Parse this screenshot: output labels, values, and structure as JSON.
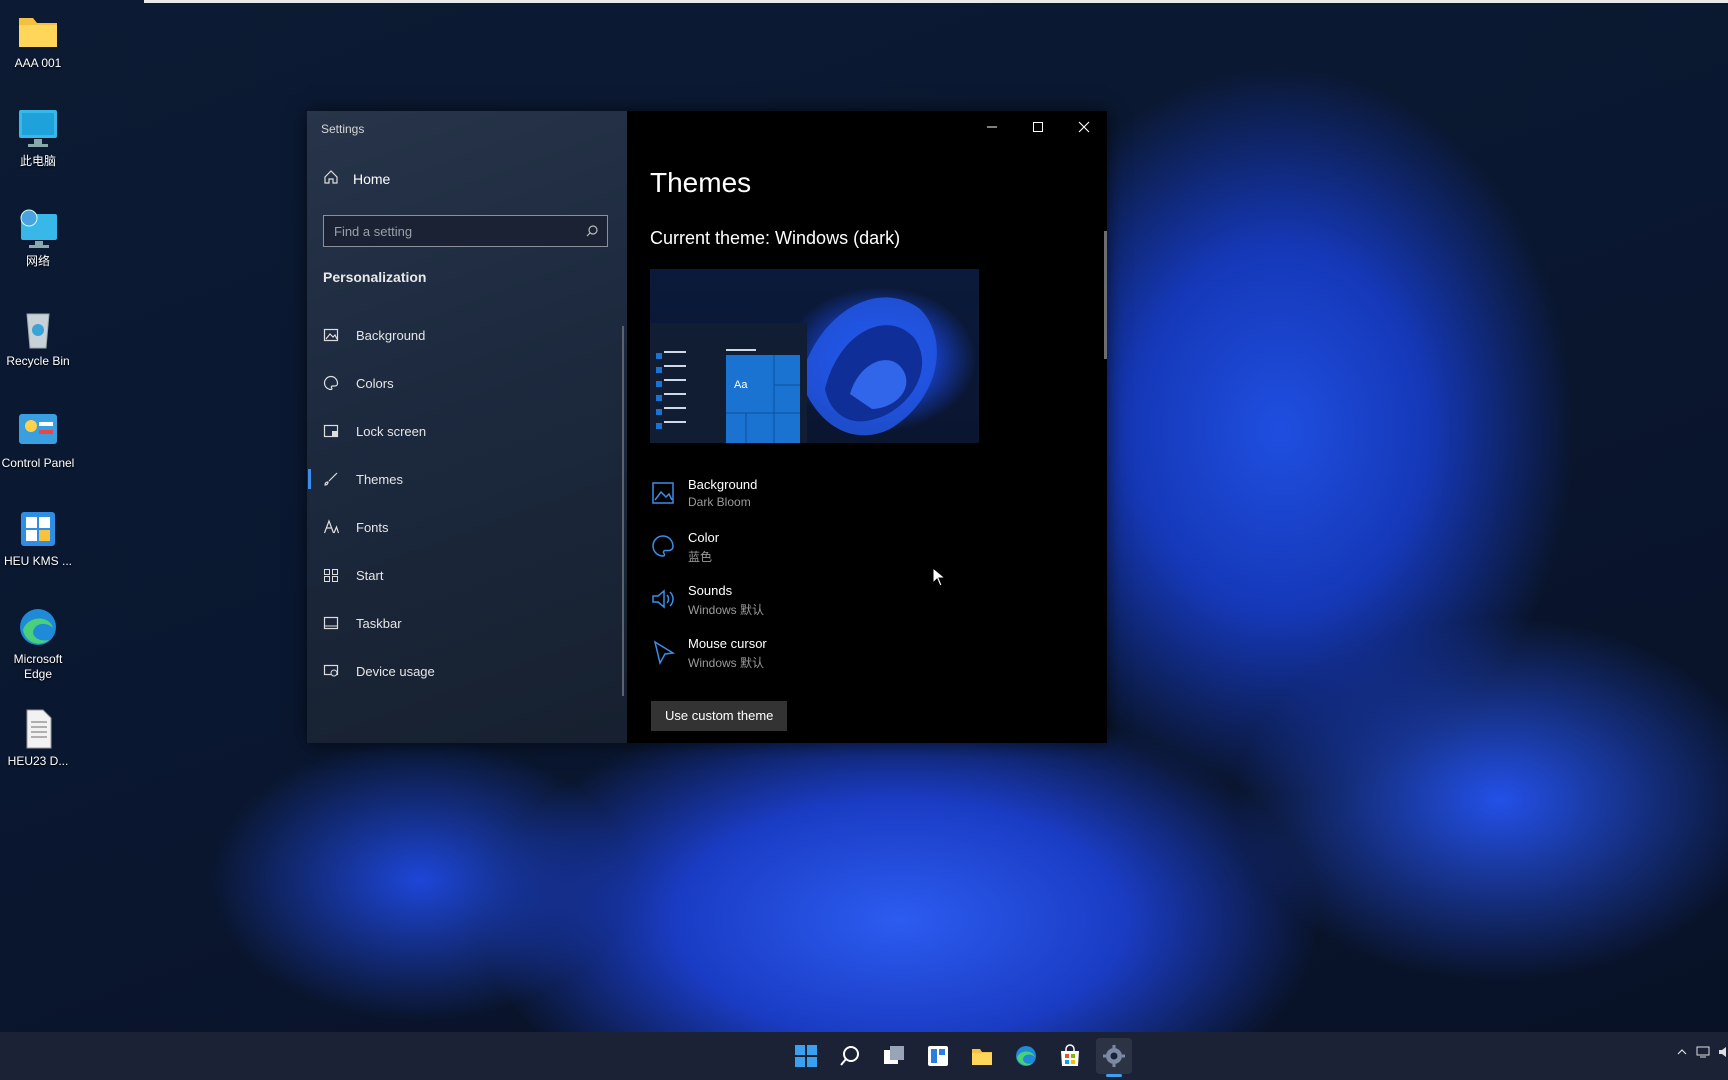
{
  "desktop": {
    "icons": [
      {
        "label": "AAA 001",
        "icon": "folder-icon"
      },
      {
        "label": "此电脑",
        "icon": "computer-icon"
      },
      {
        "label": "网络",
        "icon": "network-icon"
      },
      {
        "label": "Recycle Bin",
        "icon": "recycle-bin-icon"
      },
      {
        "label": "Control Panel",
        "icon": "control-panel-icon"
      },
      {
        "label": "HEU KMS ...",
        "icon": "kms-icon"
      },
      {
        "label": "Microsoft Edge",
        "icon": "edge-icon"
      },
      {
        "label": "HEU23 D...",
        "icon": "document-icon"
      }
    ]
  },
  "settings": {
    "title": "Settings",
    "home_label": "Home",
    "search_placeholder": "Find a setting",
    "group_header": "Personalization",
    "nav": [
      {
        "label": "Background",
        "icon": "picture-icon"
      },
      {
        "label": "Colors",
        "icon": "palette-icon"
      },
      {
        "label": "Lock screen",
        "icon": "lock-screen-icon"
      },
      {
        "label": "Themes",
        "icon": "brush-icon",
        "selected": true
      },
      {
        "label": "Fonts",
        "icon": "font-icon"
      },
      {
        "label": "Start",
        "icon": "start-icon"
      },
      {
        "label": "Taskbar",
        "icon": "taskbar-icon"
      },
      {
        "label": "Device usage",
        "icon": "device-usage-icon"
      }
    ],
    "page_title": "Themes",
    "current_theme": "Current theme: Windows (dark)",
    "preview_sample_text": "Aa",
    "properties": [
      {
        "name": "Background",
        "value": "Dark Bloom",
        "icon": "picture-icon"
      },
      {
        "name": "Color",
        "value": "蓝色",
        "icon": "palette-icon"
      },
      {
        "name": "Sounds",
        "value": "Windows 默认",
        "icon": "speaker-icon"
      },
      {
        "name": "Mouse cursor",
        "value": "Windows 默认",
        "icon": "cursor-icon"
      }
    ],
    "custom_theme_button": "Use custom theme"
  },
  "taskbar": {
    "items": [
      "start-icon",
      "search-icon",
      "task-view-icon",
      "widgets-icon",
      "file-explorer-icon",
      "edge-icon",
      "store-icon",
      "settings-icon"
    ]
  },
  "colors": {
    "accent": "#3b8eea",
    "window_bg": "#000000"
  }
}
